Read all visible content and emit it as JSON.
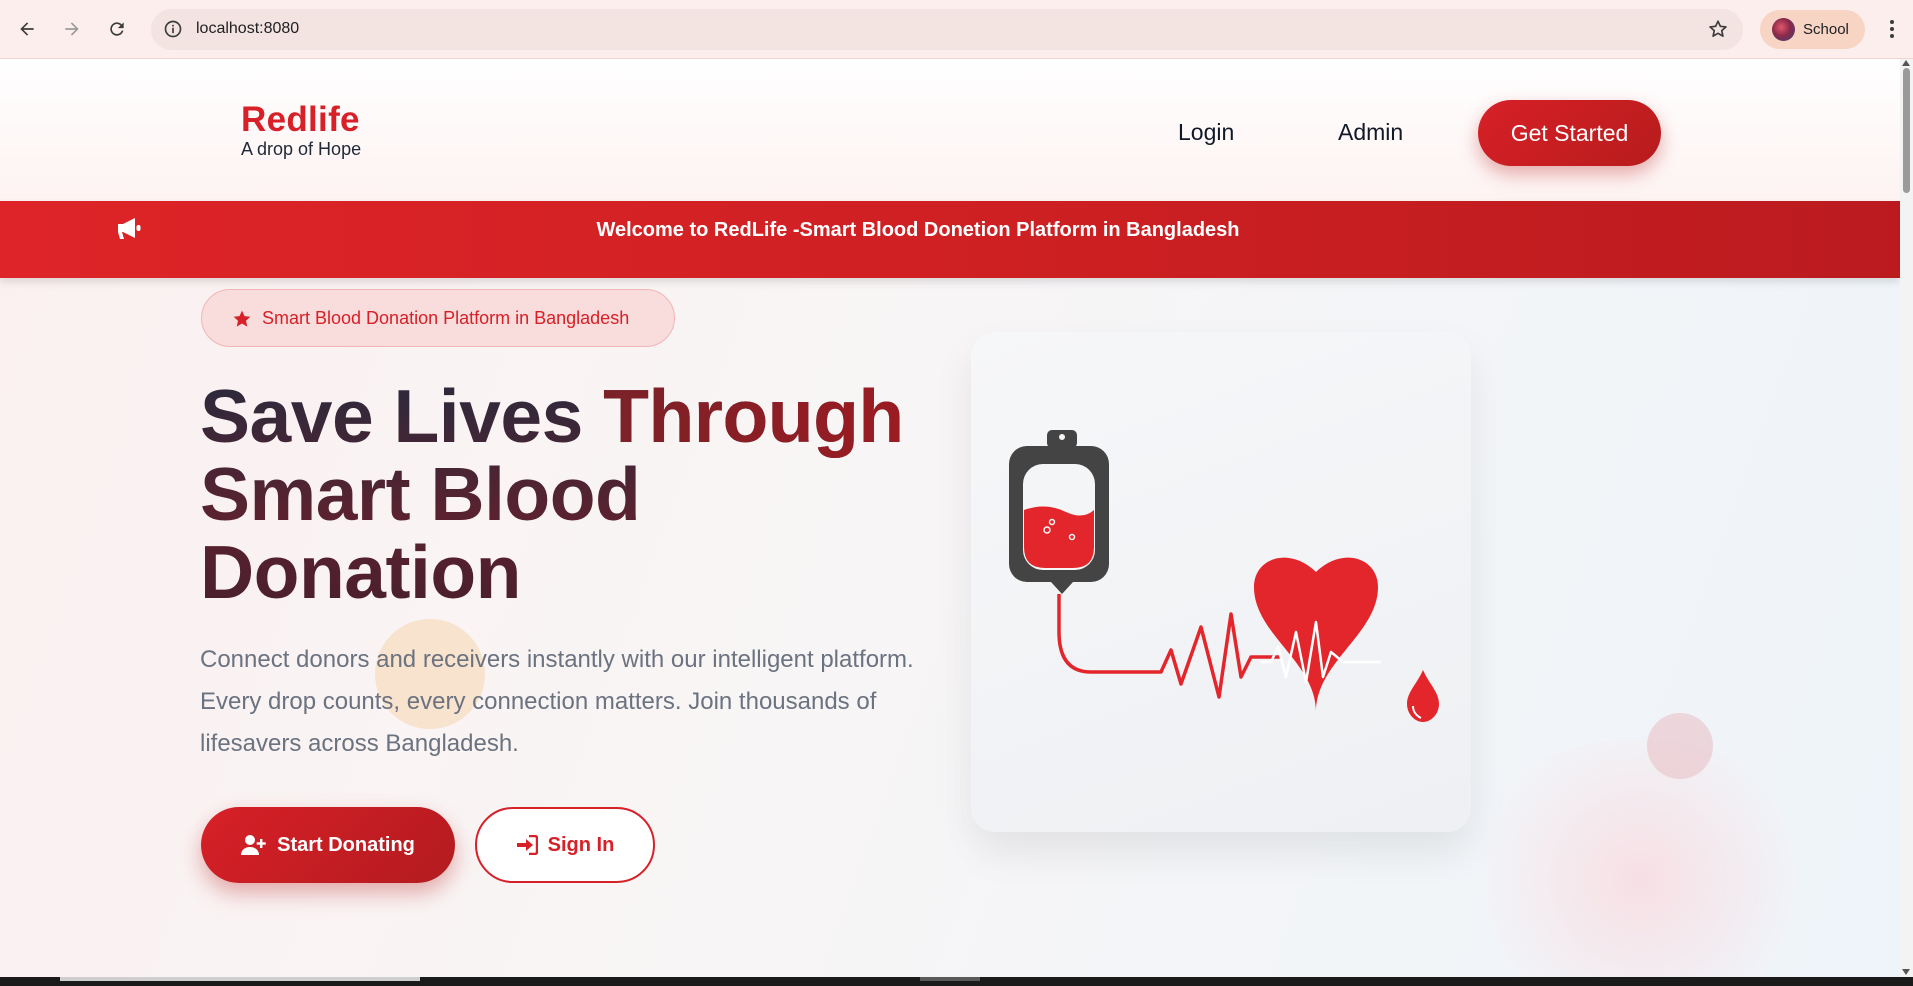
{
  "browser": {
    "url": "localhost:8080",
    "profile_label": "School"
  },
  "header": {
    "brand_name": "Redlife",
    "tagline": "A drop of Hope",
    "nav": {
      "login": "Login",
      "admin": "Admin",
      "get_started": "Get Started"
    }
  },
  "announcement": {
    "icon": "megaphone-icon",
    "text": "Welcome to RedLife -Smart Blood Donetion Platform in Bangladesh"
  },
  "hero": {
    "badge": "Smart Blood Donation Platform in Bangladesh",
    "headline_part1": "Save Lives ",
    "headline_accent": "Through",
    "headline_part2": "Smart Blood Donation",
    "description": "Connect donors and receivers instantly with our intelligent platform. Every drop counts, every connection matters. Join thousands of lifesavers across Bangladesh.",
    "primary_button": "Start Donating",
    "secondary_button": "Sign In"
  },
  "colors": {
    "brand_red": "#d72027",
    "dark_red": "#b71c1c",
    "text_gray": "#6b7280"
  }
}
